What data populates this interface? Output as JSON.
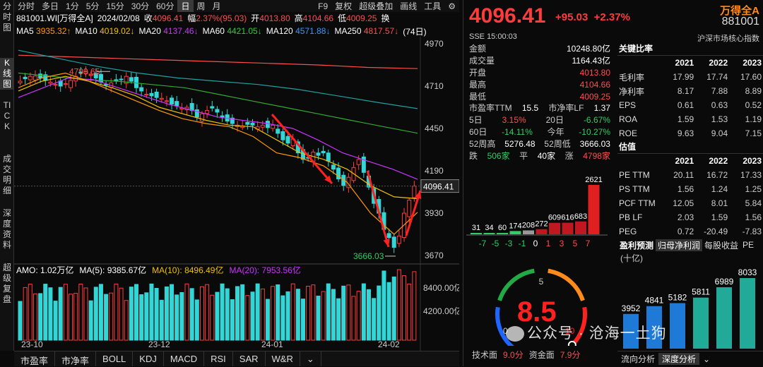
{
  "sidebar": [
    "分时图",
    "K线图",
    "TICK",
    "成交明细",
    "深度资料",
    "超级复盘"
  ],
  "toolbar": {
    "periods": [
      "分时",
      "多日",
      "1分",
      "5分",
      "15分",
      "30分",
      "60分",
      "日",
      "周",
      "月"
    ],
    "selected": "日",
    "f9": "F9",
    "fuquan": "复权",
    "overlay": "超级叠加",
    "draw": "画线",
    "tools": "工具"
  },
  "info": {
    "code": "881001.WI[万得全A]",
    "date": "2024/02/08",
    "close_l": "收",
    "close": "4096.41",
    "amp_l": "幅",
    "amp": "2.37%(95.03)",
    "open_l": "开",
    "open": "4013.80",
    "high_l": "高",
    "high": "4104.66",
    "low_l": "低",
    "low": "4009.25",
    "swap_l": "换"
  },
  "ma": {
    "ma5": "MA5",
    "ma5v": "3935.32↑",
    "ma10": "MA10",
    "ma10v": "4019.02↓",
    "ma20": "MA20",
    "ma20v": "4137.46↓",
    "ma60": "MA60",
    "ma60v": "4421.05↓",
    "ma120": "MA120",
    "ma120v": "4571.88↓",
    "ma250": "MA250",
    "ma250v": "4817.57↓",
    "days": "(74日)"
  },
  "chart_data": {
    "type": "candlestick",
    "yticks": [
      "4970",
      "4710",
      "4450",
      "4190",
      "3930",
      "3670"
    ],
    "xticks": [
      "23-10",
      "23-12",
      "24-01",
      "24-02"
    ],
    "high_label": "4799.65",
    "low_label": "3666.03",
    "last": "4096.41",
    "vol_ticks": [
      "8400.00亿",
      "4200.00亿"
    ],
    "colors": {
      "up": "#ff3b3b",
      "down": "#33d6d6"
    }
  },
  "amo": {
    "label": "AMO: 1.02万亿",
    "ma5": "MA(5): 9385.67亿",
    "ma10": "MA(10): 8496.49亿",
    "ma20": "MA(20): 7953.56亿"
  },
  "bottom_tabs": [
    "市盈率",
    "市净率",
    "BOLL",
    "KDJ",
    "MACD",
    "RSI",
    "SAR",
    "W&R"
  ],
  "quote": {
    "price": "4096.41",
    "change": "+95.03",
    "pct": "+2.37%",
    "name": "万得全A",
    "code": "881001",
    "time": "SSE 15:00:03",
    "sub": "沪深市场核心指数",
    "rows": [
      [
        "金额",
        "10248.80亿"
      ],
      [
        "成交量",
        "1164.43亿"
      ],
      [
        "开盘",
        "4013.80"
      ],
      [
        "最高",
        "4104.66"
      ],
      [
        "最低",
        "4009.25"
      ]
    ],
    "pe_l": "市盈率TTM",
    "pe": "15.5",
    "pb_l": "市净率LF",
    "pb": "1.37",
    "d5_l": "5日",
    "d5": "3.15%",
    "d20_l": "20日",
    "d20": "-6.67%",
    "d60_l": "60日",
    "d60": "-14.11%",
    "ytd_l": "今年",
    "ytd": "-10.27%",
    "h52_l": "52周高",
    "h52": "5276.48",
    "l52_l": "52周低",
    "l52": "3666.03",
    "fall_l": "跌",
    "fall": "506家",
    "flat_l": "平",
    "flat": "40家",
    "rise_l": "涨",
    "rise": "4798家"
  },
  "dist": {
    "values": [
      31,
      34,
      60,
      174,
      208,
      272,
      609,
      616,
      683,
      2621
    ],
    "labels": [
      "-7",
      "-5",
      "-3",
      "-1",
      "0",
      "1",
      "3",
      "5",
      "7"
    ]
  },
  "score": {
    "value": "8.5",
    "tick": "5",
    "zero": "0",
    "ten": "10",
    "tech_l": "技术面",
    "tech": "9.0分",
    "fund_l": "资金面",
    "fund": "7.9分"
  },
  "ratios": {
    "title": "关键比率",
    "years": [
      "2021",
      "2022",
      "2023"
    ],
    "rows": [
      [
        "毛利率",
        "17.99",
        "17.74",
        "17.60"
      ],
      [
        "净利率",
        "8.17",
        "7.88",
        "8.89"
      ],
      [
        "EPS",
        "0.61",
        "0.63",
        "0.52"
      ],
      [
        "ROA",
        "1.59",
        "1.53",
        "1.19"
      ],
      [
        "ROE",
        "9.63",
        "9.04",
        "7.15"
      ]
    ]
  },
  "valuation": {
    "title": "估值",
    "years": [
      "2021",
      "2022",
      "2023"
    ],
    "rows": [
      [
        "PE TTM",
        "20.11",
        "16.72",
        "17.33"
      ],
      [
        "PS TTM",
        "1.56",
        "1.24",
        "1.25"
      ],
      [
        "PCF TTM",
        "12.05",
        "8.01",
        "5.84"
      ],
      [
        "PB LF",
        "2.03",
        "1.59",
        "1.56"
      ],
      [
        "PEG",
        "0.72",
        "-20.49",
        "-7.83"
      ]
    ]
  },
  "forecast": {
    "tabs": [
      "盈利预测",
      "归母净利润",
      "每股收益",
      "PE"
    ],
    "unit": "(十亿)",
    "values": [
      3952,
      4841,
      5182,
      5811,
      6989,
      8033
    ]
  },
  "right_bottom": [
    "流向分析",
    "深度分析"
  ],
  "watermark": "公众号 · 沧海一土狗"
}
